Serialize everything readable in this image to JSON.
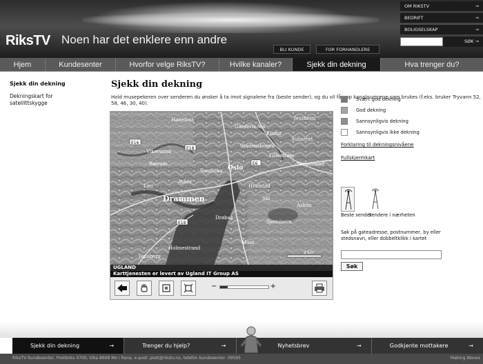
{
  "header": {
    "logo": "RiksTV",
    "tagline": "Noen har det enklere enn andre",
    "buttons": [
      "BLI KUNDE",
      "FOR FORHANDLERE"
    ],
    "top_links": [
      {
        "label": "OM RIKSTV",
        "arrow": "→"
      },
      {
        "label": "BEDRIFT",
        "arrow": "→"
      },
      {
        "label": "BOLIGSELSKAP",
        "arrow": "→"
      }
    ],
    "search_label": "SØK →"
  },
  "nav": {
    "items": [
      "Hjem",
      "Kundesenter",
      "Hvorfor velge RiksTV?",
      "Hvilke kanaler?",
      "Sjekk din dekning",
      "Hva trenger du?"
    ],
    "active": "Sjekk din dekning"
  },
  "sidebar": {
    "title": "Sjekk din dekning",
    "link": "Dekningskart for satellittskygge"
  },
  "main": {
    "title": "Sjekk din dekning",
    "intro": "Hold musepekeren over senderen du ønsker å ta imot signalene fra (beste sender), og du vil få opp kanalnumrene som brukes (f.eks. bruker Tryvann 52, 58, 46, 30, 40)."
  },
  "map": {
    "places": [
      "Hønefoss",
      "Jessheim",
      "Gardermoen",
      "Klofta",
      "Aulisetet",
      "Stadenskogen",
      "Lillestrøm",
      "Sørumsand",
      "Vikersund",
      "Sandvika",
      "Oslo",
      "Bærum",
      "Asker",
      "Drammen",
      "Lier",
      "Hvalstad",
      "Ski",
      "Drøbak",
      "Askim",
      "Sjømmern",
      "Holmestrand",
      "Moss",
      "Tønsberg",
      "E18",
      "E16",
      "E6"
    ],
    "caption_1": "UGLAND",
    "caption_2": "Karttjenesten er levert av Ugland IT Group AS",
    "scale": "2 km",
    "tools": [
      "arrow-left-icon",
      "hand-icon",
      "zoom-box-icon",
      "full-extent-icon",
      "print-icon"
    ],
    "zoom_minus": "−",
    "zoom_plus": "+",
    "zoom_level": 0.15
  },
  "legend": {
    "items": [
      {
        "label": "Svært god dekning",
        "color": "#7a7a7a"
      },
      {
        "label": "God dekning",
        "color": "#a5a5a5"
      },
      {
        "label": "Sannsynligvis dekning",
        "color": "#8e8e8e"
      },
      {
        "label": "Sannsynligvis ikke dekning",
        "color": "#ffffff"
      }
    ],
    "link_explain": "Forklaring til dekningsnivåene",
    "link_fullscreen": "Fullskjermkart",
    "antenna_1": "Beste sender",
    "antenna_2": "Sendere i nærheten",
    "search_help": "Søk på gateadresse, postnummer, by eller stedsnavn, eller dobbeltklikk i kartet",
    "search_button": "Søk"
  },
  "footer": {
    "nav": [
      {
        "label": "Sjekk din dekning",
        "arrow": "→"
      },
      {
        "label": "Trenger du hjelp?",
        "arrow": "→"
      },
      {
        "label": "Nyhetsbrev",
        "arrow": "→"
      },
      {
        "label": "Godkjente mottakere",
        "arrow": "→"
      }
    ],
    "address": "RiksTV Kundesenter, Postboks 4700, Vika 8608 Mo i Rana, e-post: post@rikstv.no, telefon kundesenter: 09595",
    "credit": "Making Waves"
  }
}
